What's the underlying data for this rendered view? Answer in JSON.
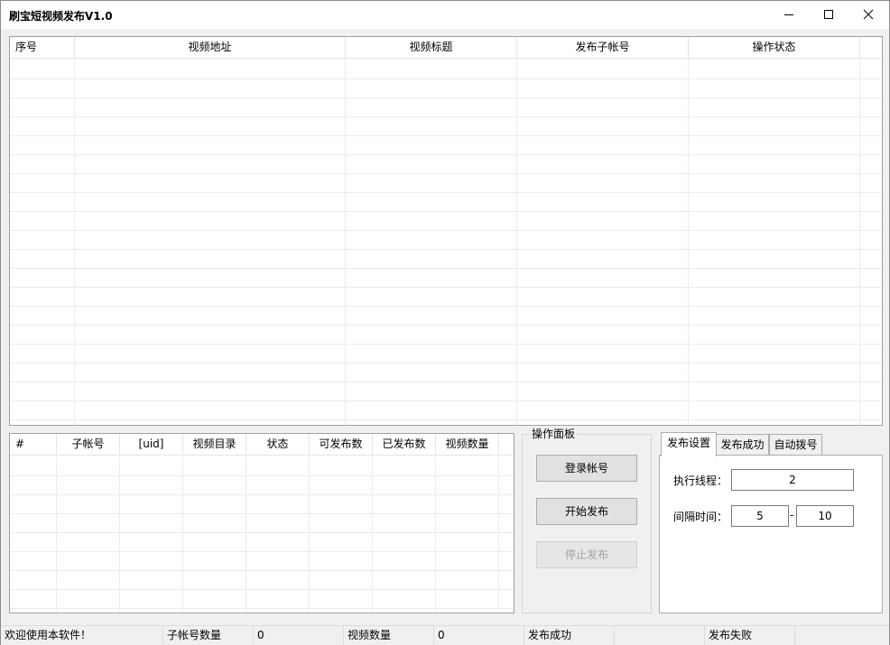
{
  "window": {
    "title": "刷宝短视频发布V1.0"
  },
  "video_table": {
    "columns": [
      "序号",
      "视频地址",
      "视频标题",
      "发布子帐号",
      "操作状态"
    ],
    "rows": []
  },
  "account_table": {
    "columns": [
      "#",
      "子帐号",
      "[uid]",
      "视频目录",
      "状态",
      "可发布数",
      "已发布数",
      "视频数量"
    ],
    "rows": []
  },
  "operation_panel": {
    "label": "操作面板",
    "login_button": "登录帐号",
    "start_button": "开始发布",
    "stop_button": "停止发布"
  },
  "settings": {
    "tabs": [
      "发布设置",
      "发布成功",
      "自动拨号"
    ],
    "active_tab": "发布设置",
    "threads_label": "执行线程：",
    "threads_value": "2",
    "interval_label": "间隔时间：",
    "interval_min": "5",
    "interval_separator": "-",
    "interval_max": "10"
  },
  "statusbar": {
    "welcome": "欢迎使用本软件！",
    "account_count_label": "子帐号数量",
    "account_count_value": "0",
    "video_count_label": "视频数量",
    "video_count_value": "0",
    "success_label": "发布成功",
    "success_value": "",
    "fail_label": "发布失败",
    "fail_value": ""
  }
}
